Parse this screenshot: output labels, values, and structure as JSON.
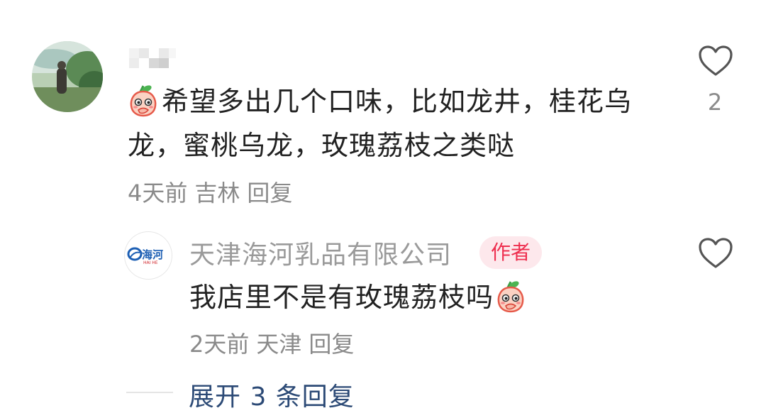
{
  "comment": {
    "username": "",
    "text": "希望多出几个口味，比如龙井，桂花乌龙，蜜桃乌龙，玫瑰荔枝之类哒",
    "time": "4天前",
    "location": "吉林",
    "reply_label": "回复",
    "likes": "2",
    "emoji": "peach-emoji"
  },
  "reply": {
    "author_name": "天津海河乳品有限公司",
    "author_badge": "作者",
    "avatar_text": "海河",
    "avatar_subtext": "HAI HE",
    "text": "我店里不是有玫瑰荔枝吗",
    "time": "2天前",
    "location": "天津",
    "reply_label": "回复",
    "emoji": "peach-emoji"
  },
  "expand_label": "展开 3 条回复",
  "colors": {
    "text_primary": "#222222",
    "text_meta": "#8a8a8a",
    "badge_bg": "#fde8ec",
    "badge_text": "#ee2f4f",
    "link": "#2c4a76"
  }
}
